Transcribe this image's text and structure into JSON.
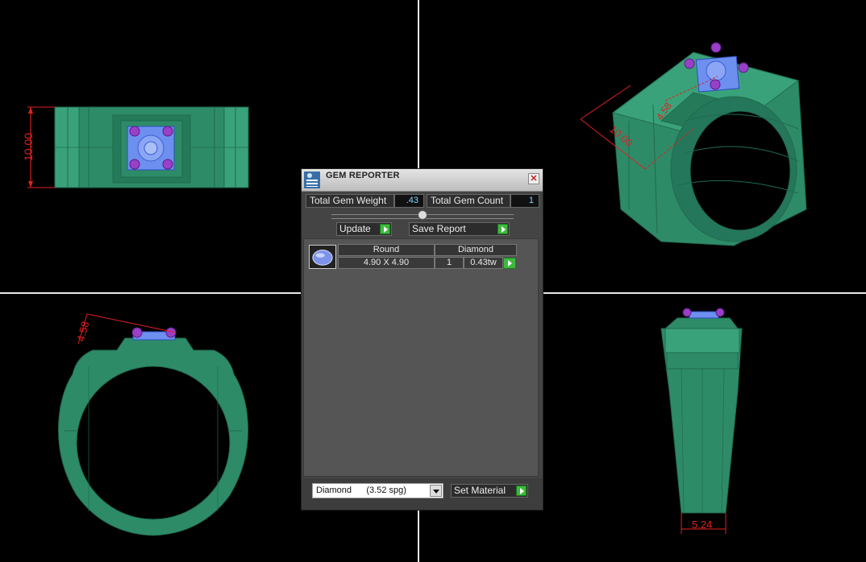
{
  "panel": {
    "title": "GEM REPORTER",
    "close_glyph": "✕",
    "total_weight_label": "Total Gem Weight",
    "total_weight_value": ".43",
    "total_count_label": "Total Gem Count",
    "total_count_value": "1",
    "update_label": "Update",
    "save_report_label": "Save Report",
    "gem_table": {
      "headers": [
        "Round",
        "Diamond"
      ],
      "row": {
        "size": "4.90 X 4.90",
        "count": "1",
        "weight": "0.43tw"
      }
    },
    "material_select": "Diamond      (3.52 spg)",
    "set_material_label": "Set Material"
  },
  "viewports": {
    "top": {
      "dimension": "10.00"
    },
    "front": {
      "dimension": "4.58"
    },
    "side": {
      "dimension": "5.24"
    },
    "perspective": {
      "dimension_a": "10.00",
      "dimension_b": "4.58"
    }
  },
  "colors": {
    "ring_green": "#2e8b68",
    "ring_green_light": "#3aa27a",
    "mesh_line": "#1f6b4e",
    "gem_blue": "#6d8ff0",
    "prong_purple": "#9a3fc8",
    "dimension_red": "#e02020",
    "go_button_green": "#3dba3d"
  },
  "icons": [
    "gem-reporter-app-icon",
    "close-icon",
    "go-arrow-icon",
    "dropdown-arrow-icon",
    "slider-knob-icon",
    "round-gem-thumbnail-icon"
  ]
}
